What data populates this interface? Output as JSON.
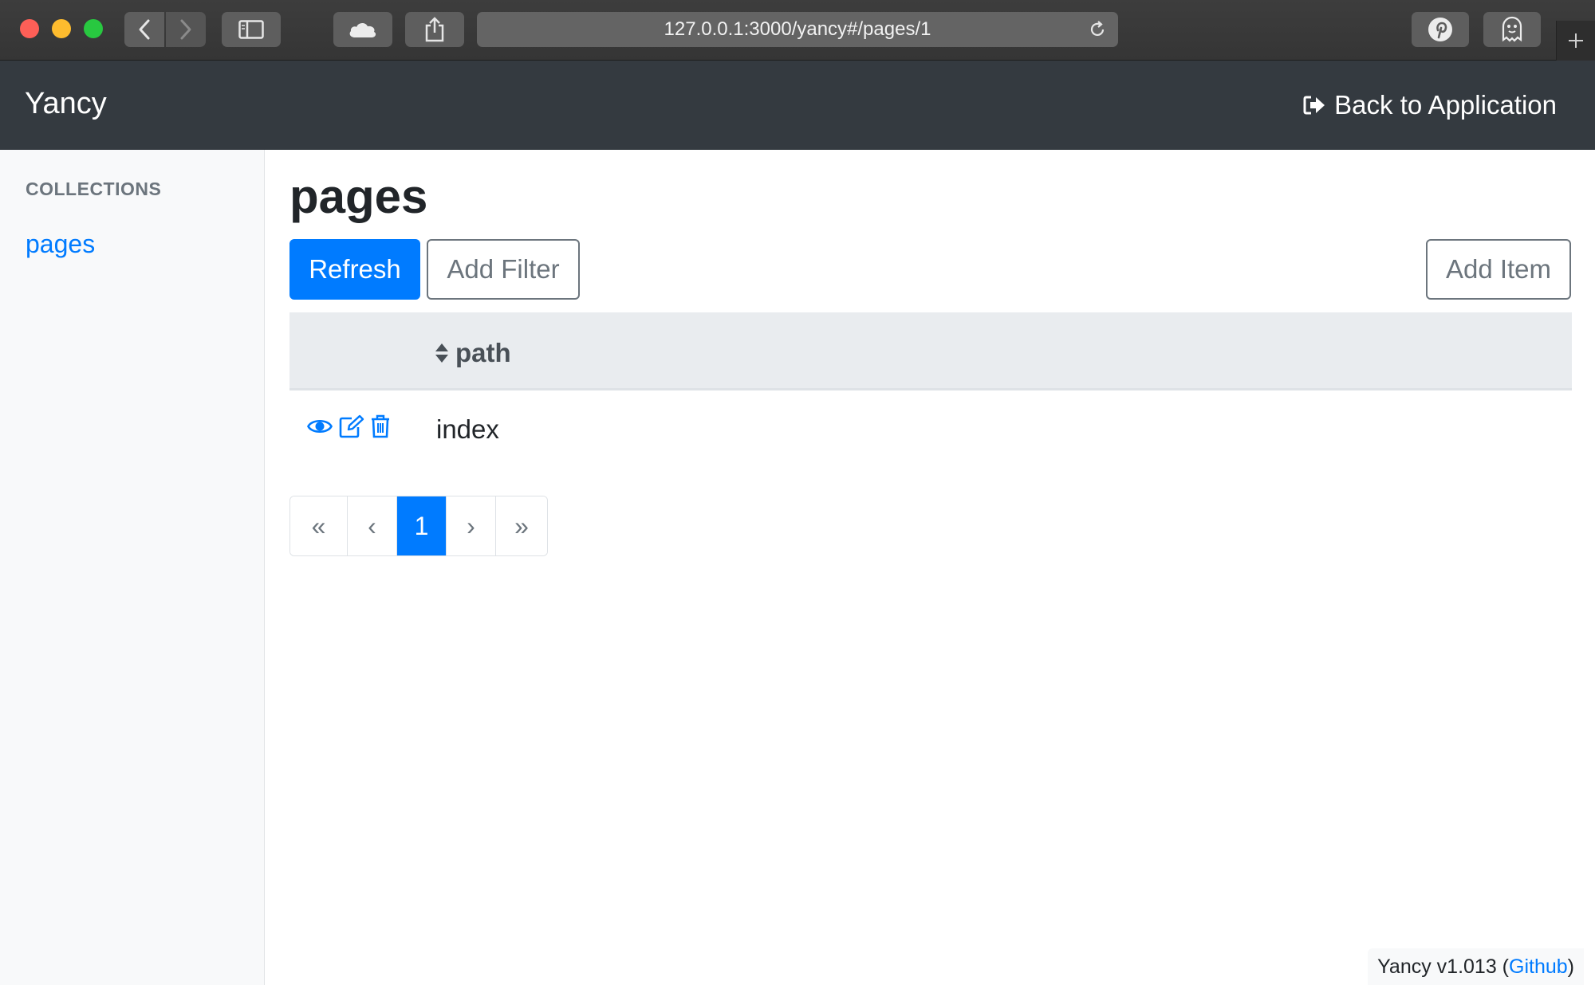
{
  "browser": {
    "url": "127.0.0.1:3000/yancy#/pages/1"
  },
  "navbar": {
    "brand": "Yancy",
    "back_label": "Back to Application"
  },
  "sidebar": {
    "heading": "COLLECTIONS",
    "items": [
      {
        "label": "pages"
      }
    ]
  },
  "main": {
    "title": "pages",
    "buttons": {
      "refresh": "Refresh",
      "add_filter": "Add Filter",
      "add_item": "Add Item"
    },
    "table": {
      "columns": [
        "path"
      ],
      "rows": [
        {
          "path": "index"
        }
      ]
    },
    "pagination": {
      "first": "«",
      "prev": "‹",
      "current": "1",
      "next": "›",
      "last": "»"
    }
  },
  "footer": {
    "version": "Yancy v1.013 (",
    "link": "Github",
    "close": ")"
  },
  "colors": {
    "primary": "#007bff",
    "navbar": "#343a40",
    "sidebar_bg": "#f8f9fa",
    "table_head": "#e9ecef"
  },
  "icons": {
    "row_actions": [
      "eye-icon",
      "edit-icon",
      "trash-icon"
    ],
    "sort": "sort-icon",
    "back": "sign-out-icon"
  }
}
